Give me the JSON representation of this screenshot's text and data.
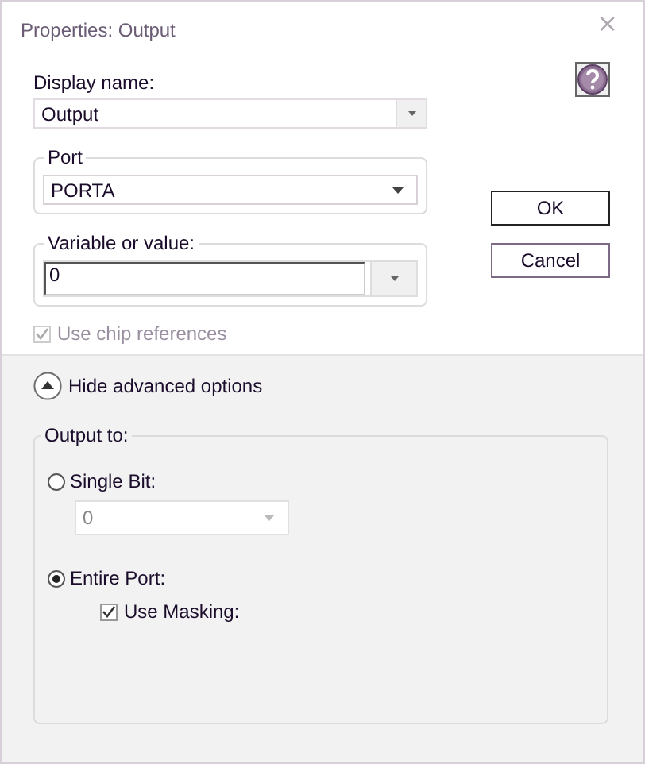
{
  "window": {
    "title": "Properties: Output",
    "close": "×"
  },
  "display_name": {
    "label": "Display name:",
    "value": "Output"
  },
  "port": {
    "label": "Port",
    "value": "PORTA"
  },
  "variable": {
    "label": "Variable or value:",
    "value": "0"
  },
  "use_chip_references": {
    "label": "Use chip references",
    "checked": true,
    "disabled": true
  },
  "buttons": [
    {
      "label": "OK",
      "default": true
    },
    {
      "label": "Cancel",
      "default": false
    }
  ],
  "advanced_toggle": {
    "label": "Hide advanced options",
    "expanded": true
  },
  "output_to": {
    "label": "Output to:",
    "options": [
      {
        "kind": "combo",
        "label": "Single Bit:",
        "selected": false,
        "value": "0",
        "disabled": true
      },
      {
        "kind": "checkbox",
        "label": "Entire Port:",
        "selected": true,
        "check_label": "Use Masking:",
        "checked": true
      }
    ]
  }
}
